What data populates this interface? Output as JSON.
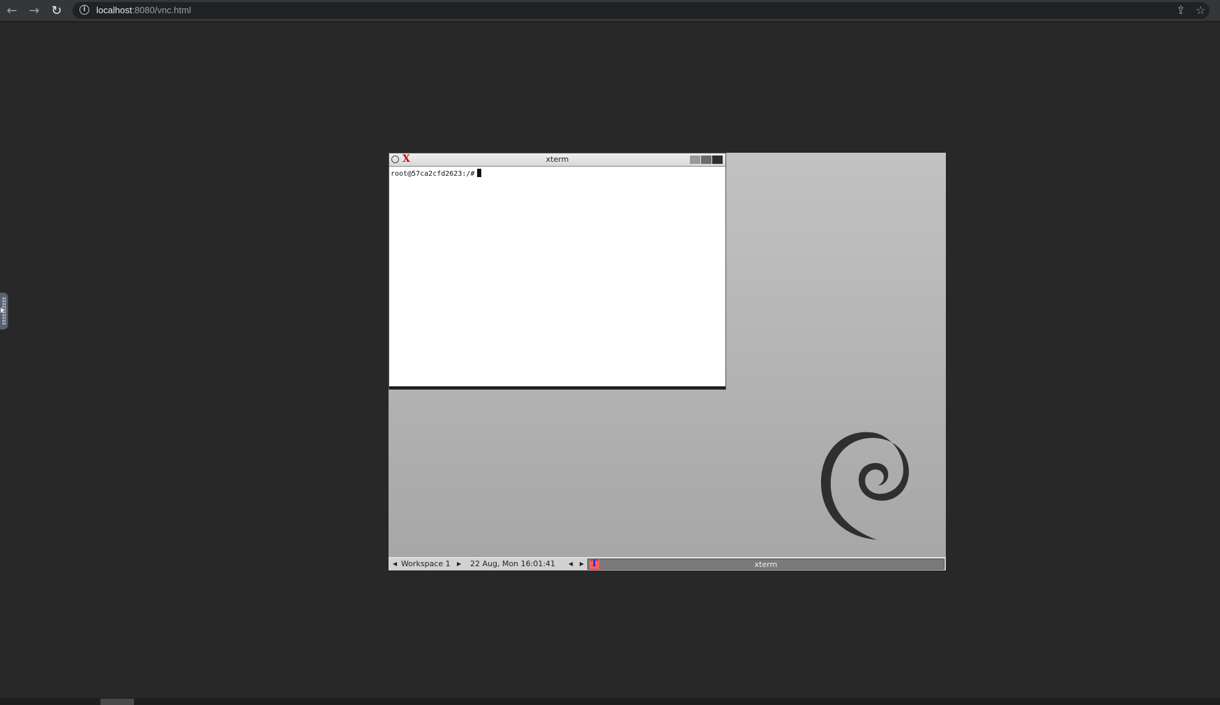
{
  "browser": {
    "url_host": "localhost",
    "url_rest": ":8080/vnc.html",
    "back_icon": "←",
    "forward_icon": "→",
    "reload_icon": "↻",
    "share_icon": "⇪",
    "star_icon": "☆"
  },
  "xterm": {
    "title": "xterm",
    "prompt": "root@57ca2cfd2623:/#"
  },
  "taskbar": {
    "workspace": "Workspace 1",
    "clock": "22 Aug, Mon 16:01:41",
    "task_label": "xterm",
    "left_arrow": "◀",
    "right_arrow": "▶"
  }
}
